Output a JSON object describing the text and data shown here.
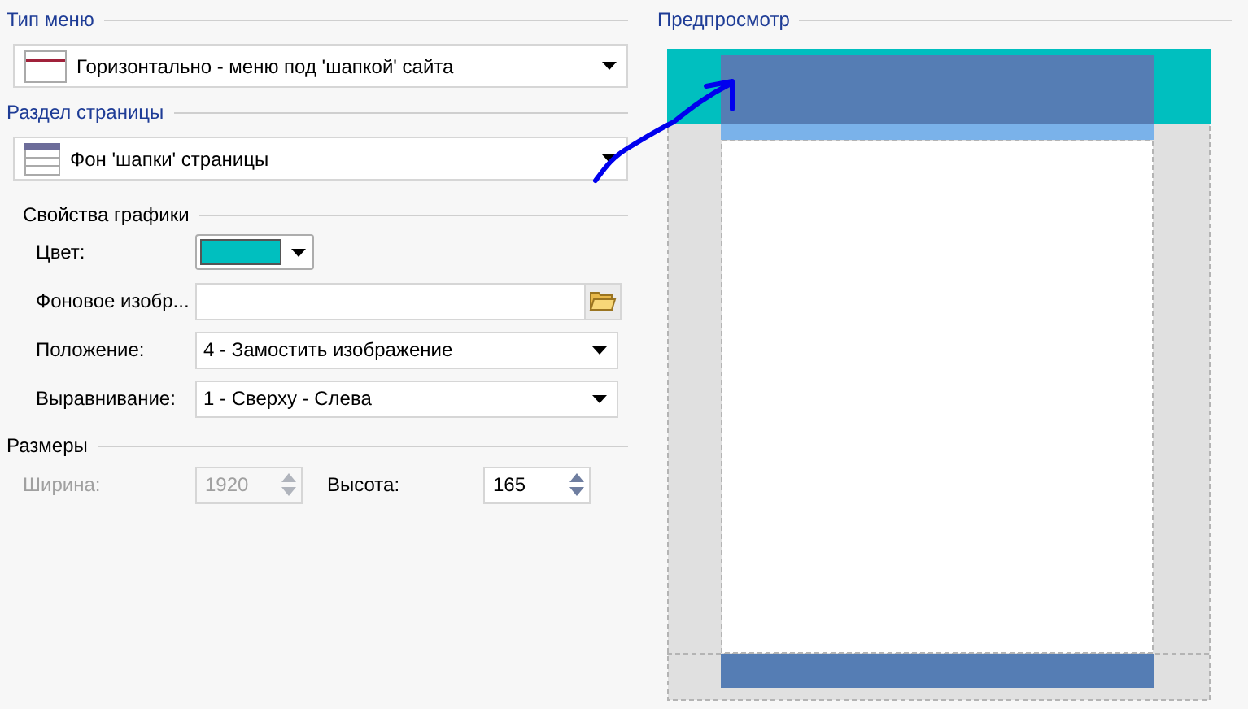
{
  "menu_type": {
    "title": "Тип меню",
    "value": "Горизонтально - меню под 'шапкой' сайта"
  },
  "page_section": {
    "title": "Раздел страницы",
    "value": "Фон 'шапки' страницы"
  },
  "graphics": {
    "title": "Свойства графики",
    "color": {
      "label": "Цвет:",
      "color": "#00bfbf"
    },
    "image": {
      "label": "Фоновое изобр..."
    },
    "position": {
      "label": "Положение:",
      "value": "4 - Замостить изображение"
    },
    "alignment": {
      "label": "Выравнивание:",
      "value": "1 - Сверху - Слева"
    }
  },
  "sizes": {
    "title": "Размеры",
    "fields": [
      {
        "label": "Ширина:",
        "value": "1920",
        "disabled": true
      },
      {
        "label": "Высота:",
        "value": "165",
        "disabled": false
      }
    ]
  },
  "preview": {
    "title": "Предпросмотр"
  }
}
